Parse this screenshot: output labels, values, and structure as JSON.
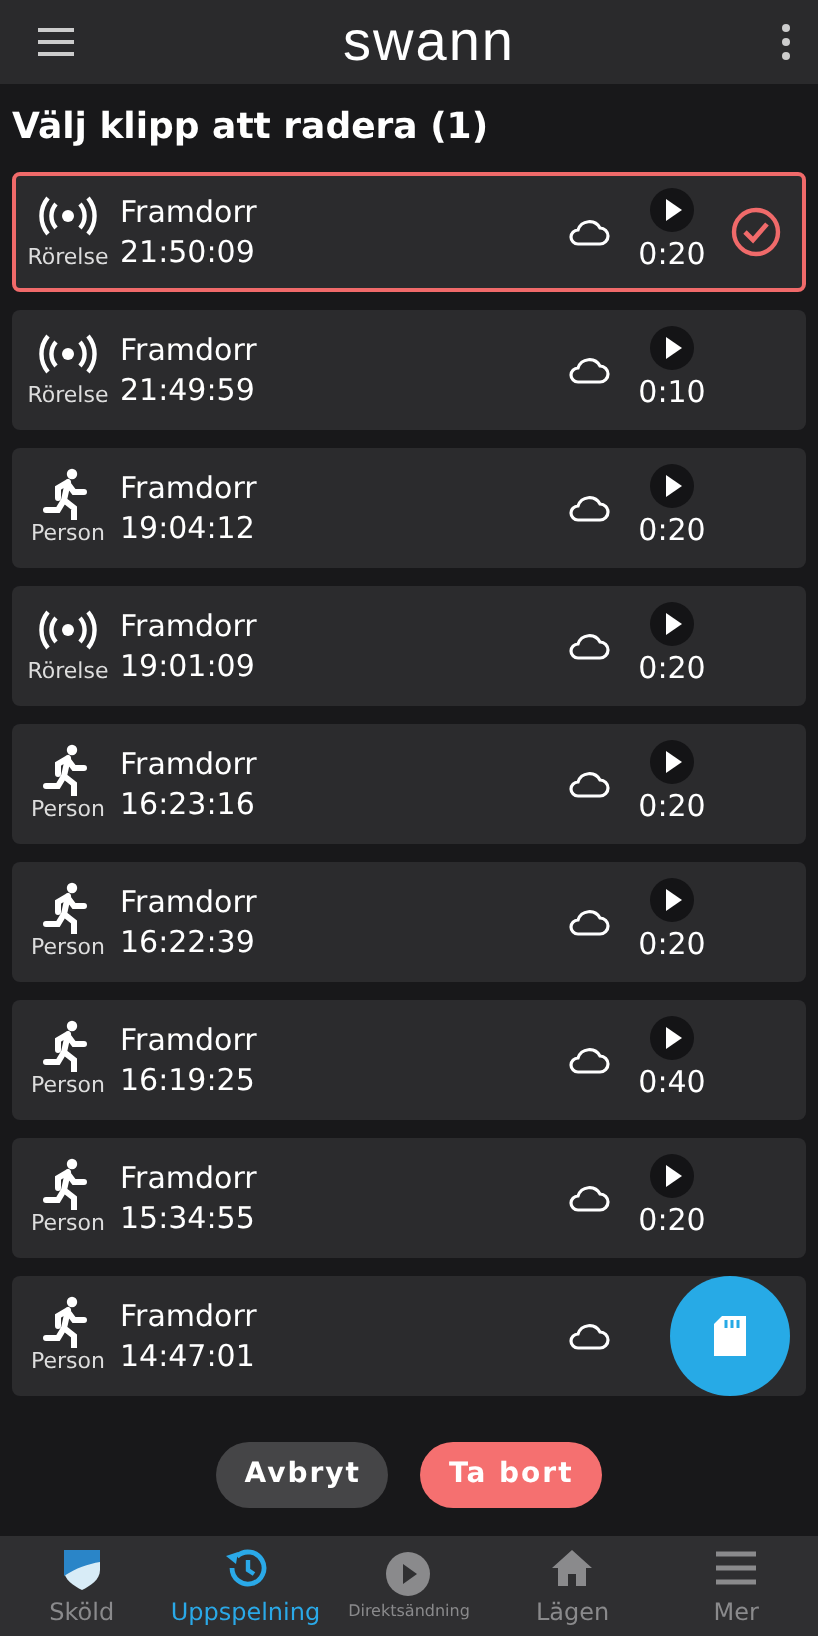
{
  "header": {
    "logo": "swann"
  },
  "title": "Välj klipp att radera (1)",
  "clips": [
    {
      "kind": "motion",
      "type_label": "Rörelse",
      "camera": "Framdorr",
      "time": "21:50:09",
      "duration": "0:20",
      "selected": true
    },
    {
      "kind": "motion",
      "type_label": "Rörelse",
      "camera": "Framdorr",
      "time": "21:49:59",
      "duration": "0:10",
      "selected": false
    },
    {
      "kind": "person",
      "type_label": "Person",
      "camera": "Framdorr",
      "time": "19:04:12",
      "duration": "0:20",
      "selected": false
    },
    {
      "kind": "motion",
      "type_label": "Rörelse",
      "camera": "Framdorr",
      "time": "19:01:09",
      "duration": "0:20",
      "selected": false
    },
    {
      "kind": "person",
      "type_label": "Person",
      "camera": "Framdorr",
      "time": "16:23:16",
      "duration": "0:20",
      "selected": false
    },
    {
      "kind": "person",
      "type_label": "Person",
      "camera": "Framdorr",
      "time": "16:22:39",
      "duration": "0:20",
      "selected": false
    },
    {
      "kind": "person",
      "type_label": "Person",
      "camera": "Framdorr",
      "time": "16:19:25",
      "duration": "0:40",
      "selected": false
    },
    {
      "kind": "person",
      "type_label": "Person",
      "camera": "Framdorr",
      "time": "15:34:55",
      "duration": "0:20",
      "selected": false
    },
    {
      "kind": "person",
      "type_label": "Person",
      "camera": "Framdorr",
      "time": "14:47:01",
      "selected": false
    }
  ],
  "actions": {
    "cancel": "Avbryt",
    "delete": "Ta bort"
  },
  "nav": [
    {
      "kind": "shield",
      "label": "Sköld",
      "selected": false
    },
    {
      "kind": "history",
      "label": "Uppspelning",
      "selected": true
    },
    {
      "kind": "play",
      "label": "Direktsändning",
      "selected": false
    },
    {
      "kind": "home",
      "label": "Lägen",
      "selected": false
    },
    {
      "kind": "menu",
      "label": "Mer",
      "selected": false
    }
  ]
}
